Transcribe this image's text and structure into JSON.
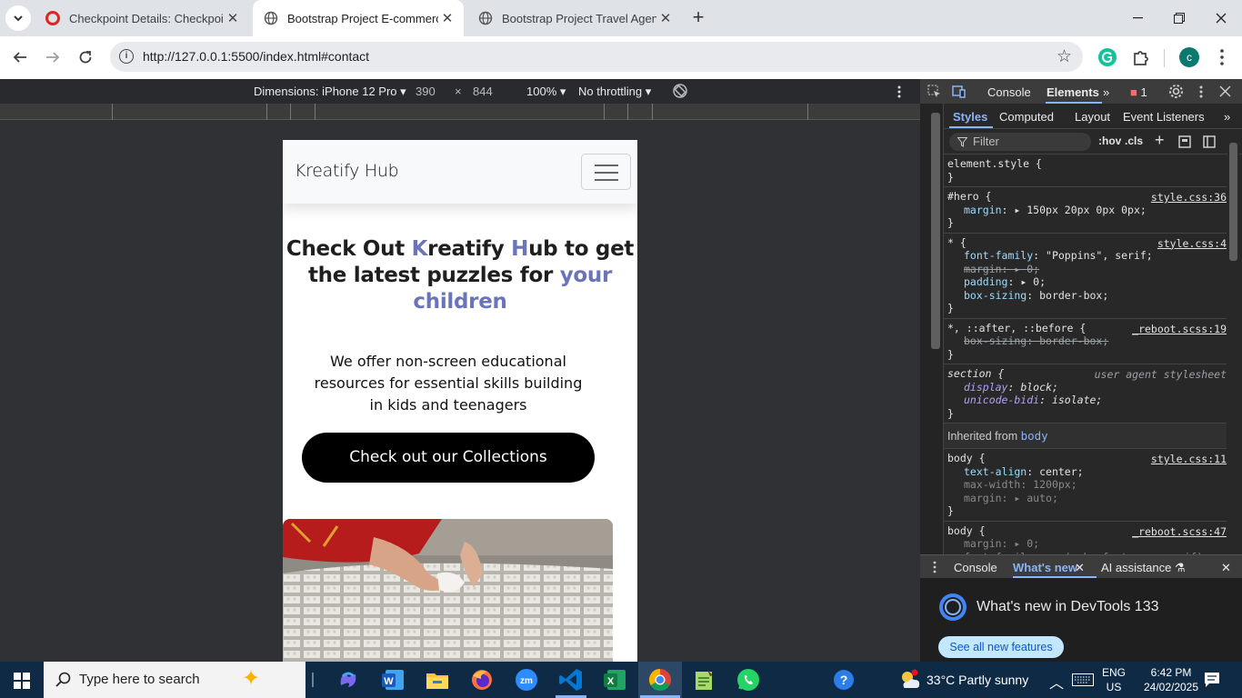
{
  "browser": {
    "tabs": [
      {
        "title": "Checkpoint Details: Checkpoint",
        "active": false
      },
      {
        "title": "Bootstrap Project E-commerce",
        "active": true
      },
      {
        "title": "Bootstrap Project Travel Agency",
        "active": false
      }
    ],
    "url": "http://127.0.0.1:5500/index.html#contact",
    "profile_initial": "c"
  },
  "device_toolbar": {
    "dimensions_label": "Dimensions: iPhone 12 Pro",
    "width": "390",
    "times": "×",
    "height": "844",
    "zoom": "100%",
    "throttling": "No throttling"
  },
  "page": {
    "brand": "Kreatify Hub",
    "hero_title": {
      "part1": "Check Out ",
      "k": "K",
      "part2": "reatify ",
      "h": "H",
      "part3": "ub to get the latest puzzles for ",
      "part4": "your children"
    },
    "hero_subtitle": "We offer non-screen educational resources for essential skills building in kids and teenagers",
    "cta_label": "Check out our Collections"
  },
  "devtools": {
    "top_tabs": {
      "console": "Console",
      "elements": "Elements",
      "error_count": "1"
    },
    "sub_tabs": [
      "Styles",
      "Computed",
      "Layout",
      "Event Listeners"
    ],
    "filter_placeholder": "Filter",
    "hov": ":hov",
    "cls": ".cls",
    "rules": {
      "r0": {
        "selector": "element.style {",
        "close": "}"
      },
      "r1": {
        "selector": "#hero {",
        "source": "style.css:36",
        "p1n": "margin",
        "p1v": "150px 20px 0px 0px;",
        "close": "}"
      },
      "r2": {
        "selector": "* {",
        "source": "style.css:4",
        "p1n": "font-family",
        "p1v": "\"Poppins\", serif;",
        "p2n": "margin",
        "p2v": "0;",
        "p3n": "padding",
        "p3v": "0;",
        "p4n": "box-sizing",
        "p4v": "border-box;",
        "close": "}"
      },
      "r3": {
        "selector": "*, ::after, ::before {",
        "source": "_reboot.scss:19",
        "p1n": "box-sizing",
        "p1v": "border-box;",
        "close": "}"
      },
      "r4": {
        "selector": "section {",
        "source": "user agent stylesheet",
        "p1n": "display",
        "p1v": "block;",
        "p2n": "unicode-bidi",
        "p2v": "isolate;",
        "close": "}"
      },
      "inherited_label": "Inherited from",
      "inherited_from": "body",
      "r5": {
        "selector": "body {",
        "source": "style.css:11",
        "p1n": "text-align",
        "p1v": "center;",
        "p2n": "max-width",
        "p2v": "1200px;",
        "p3n": "margin",
        "p3v": "auto;",
        "close": "}"
      },
      "r6": {
        "selector": "body {",
        "source": "_reboot.scss:47",
        "p1n": "margin",
        "p1v": "0;",
        "p2n": "font-family",
        "p2v": "var(--bs-font-sans-serif);"
      }
    },
    "drawer_tabs": [
      "Console",
      "What's new",
      "AI assistance"
    ],
    "whats_new_title": "What's new in DevTools 133",
    "see_all": "See all new features"
  },
  "taskbar": {
    "search_placeholder": "Type here to search",
    "weather": "33°C  Partly sunny",
    "lang1": "ENG",
    "lang2": "US",
    "time": "6:42 PM",
    "date": "24/02/2025"
  }
}
